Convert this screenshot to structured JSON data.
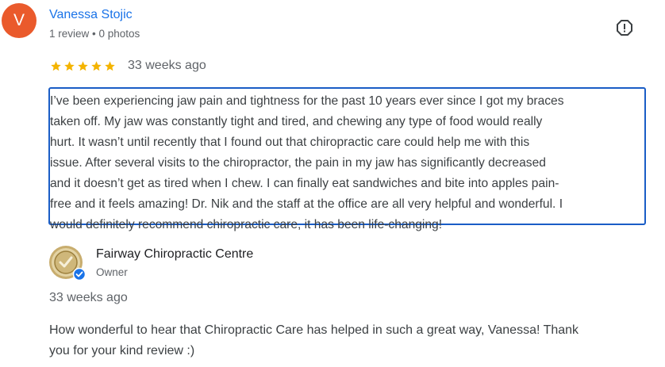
{
  "review": {
    "avatar_letter": "V",
    "avatar_color": "#ea5a2c",
    "reviewer_name": "Vanessa Stojic",
    "reviewer_meta": "1 review • 0 photos",
    "flag_icon": "report-flag-icon",
    "rating": 5,
    "rating_max": 5,
    "star_color": "#f4b400",
    "date": "33 weeks ago",
    "text_lines": [
      "I’ve been experiencing jaw pain and tightness for the past 10 years ever since I got my braces",
      "taken off. My jaw was constantly tight and tired, and chewing any type of food would really",
      "hurt. It wasn’t until recently that I found out that chiropractic care could help me with this",
      "issue. After several visits to the chiropractor, the pain in my jaw has significantly decreased",
      "and it doesn’t get as tired when I chew. I can finally eat sandwiches and bite into apples pain-",
      "free and it feels amazing! Dr. Nik and the staff at the office are all very helpful and wonderful. I",
      "would definitely recommend chiropractic care, it has been life-changing!"
    ],
    "selection_border_color": "#1a5dc6"
  },
  "owner_response": {
    "logo_icon": "business-logo-icon",
    "verified_icon": "verified-badge-icon",
    "name": "Fairway Chiropractic Centre",
    "role": "Owner",
    "date": "33 weeks ago",
    "text_lines": [
      "How wonderful to hear that Chiropractic Care has helped in such a great way, Vanessa! Thank",
      "you for your kind review :)"
    ]
  }
}
